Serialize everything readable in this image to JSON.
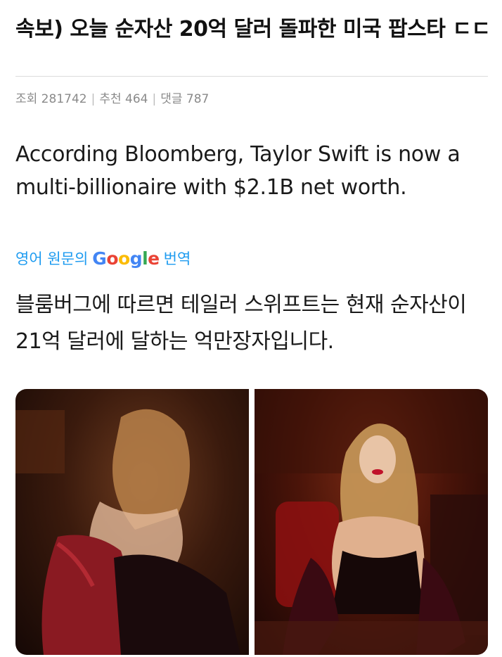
{
  "post": {
    "title": "속보) 오늘 순자산 20억 달러 돌파한 미국 팝스타 ㄷㄷ",
    "meta": {
      "views_label": "조회 281742",
      "recommend_label": "추천 464",
      "comments_label": "댓글 787"
    }
  },
  "tweet": {
    "text": "According Bloomberg, Taylor Swift is now a multi-billionaire with $2.1B net worth.",
    "translate_prefix": "영어 원문의",
    "translate_google": "Google",
    "translate_suffix": "번역",
    "translated_text": "블룸버그에 따르면 테일러 스위프트는 현재 순자산이 21억 달러에 달하는 억만장자입니다."
  },
  "colors": {
    "link_blue": "#1d9bf0",
    "meta_gray": "#8a8a8a"
  }
}
